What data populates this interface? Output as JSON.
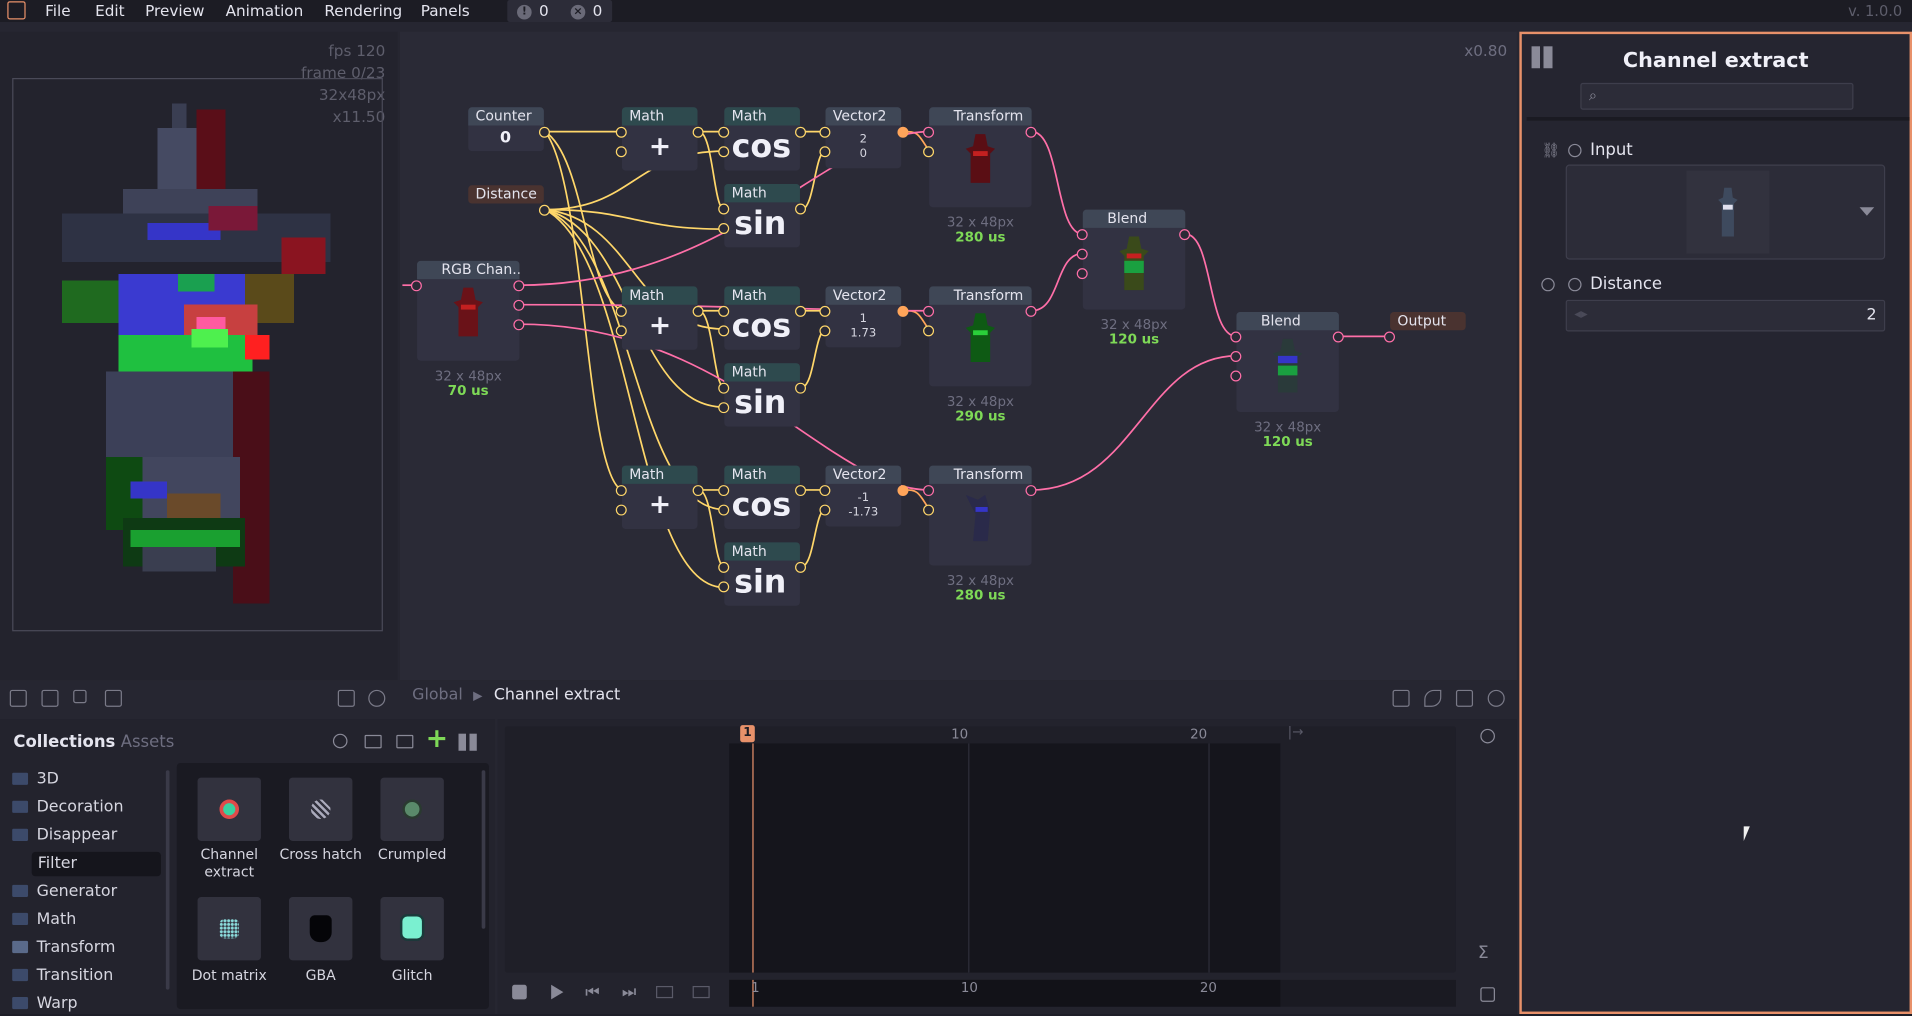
{
  "menu": {
    "items": [
      "File",
      "Edit",
      "Preview",
      "Animation",
      "Rendering",
      "Panels"
    ],
    "warnings": "0",
    "errors": "0",
    "version": "v. 1.0.0"
  },
  "preview": {
    "fps": "fps 120",
    "frame": "frame 0/23",
    "size": "32x48px",
    "zoom": "x11.50"
  },
  "graph": {
    "zoom": "x0.80",
    "breadcrumb_root": "Global",
    "breadcrumb_current": "Channel extract",
    "nodes": {
      "counter": {
        "title": "Counter",
        "value": "0"
      },
      "distance": {
        "title": "Distance"
      },
      "rgb": {
        "title": "RGB Chan...",
        "dim": "32 x 48px",
        "time": "70 us"
      },
      "math_labels": "Math",
      "plus": "+",
      "cos": "cos",
      "sin": "sin",
      "vector2": "Vector2",
      "vec1": [
        "2",
        "0"
      ],
      "vec2": [
        "1",
        "1.73"
      ],
      "vec3": [
        "-1",
        "-1.73"
      ],
      "transform": "Transform",
      "t1": {
        "dim": "32 x 48px",
        "time": "280 us"
      },
      "t2": {
        "dim": "32 x 48px",
        "time": "290 us"
      },
      "t3": {
        "dim": "32 x 48px",
        "time": "280 us"
      },
      "blend": "Blend",
      "b1": {
        "dim": "32 x 48px",
        "time": "120 us"
      },
      "b2": {
        "dim": "32 x 48px",
        "time": "120 us"
      },
      "output": "Output"
    }
  },
  "collections": {
    "tab_collections": "Collections",
    "tab_assets": "Assets",
    "folders": [
      "3D",
      "Decoration",
      "Disappear",
      "Filter",
      "Generator",
      "Math",
      "Transform",
      "Transition",
      "Warp"
    ],
    "selected": "Filter",
    "items": [
      {
        "label": "Channel extract"
      },
      {
        "label": "Cross hatch"
      },
      {
        "label": "Crumpled"
      },
      {
        "label": "Dot matrix"
      },
      {
        "label": "GBA"
      },
      {
        "label": "Glitch"
      }
    ]
  },
  "timeline": {
    "current_frame": "1",
    "ticks": [
      "10",
      "20"
    ],
    "bottom_ticks": [
      "1",
      "10",
      "20"
    ]
  },
  "inspector": {
    "title": "Channel extract",
    "search_placeholder": "",
    "input_label": "Input",
    "distance_label": "Distance",
    "distance_value": "2"
  },
  "colors": {
    "accent": "#e8916a",
    "time_green": "#7ed957",
    "wire_yellow": "#ffd76a",
    "wire_pink": "#ff6fa8"
  }
}
